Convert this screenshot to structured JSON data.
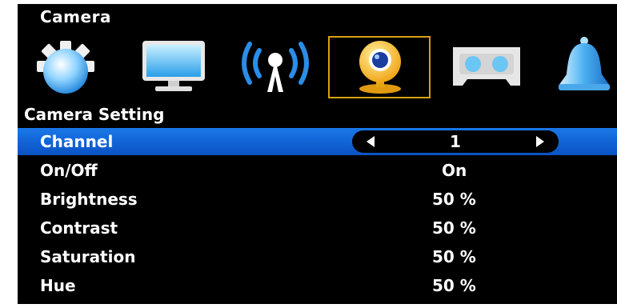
{
  "header": {
    "title": "Camera"
  },
  "icons": [
    {
      "name": "gear-icon"
    },
    {
      "name": "monitor-icon"
    },
    {
      "name": "wireless-icon"
    },
    {
      "name": "webcam-icon",
      "selected": true
    },
    {
      "name": "cassette-icon"
    },
    {
      "name": "bell-icon"
    }
  ],
  "section": {
    "title": "Camera Setting"
  },
  "settings": [
    {
      "label": "Channel",
      "value": "1",
      "selected": true
    },
    {
      "label": "On/Off",
      "value": "On"
    },
    {
      "label": "Brightness",
      "value": "50 %"
    },
    {
      "label": "Contrast",
      "value": "50 %"
    },
    {
      "label": "Saturation",
      "value": "50 %"
    },
    {
      "label": "Hue",
      "value": "50 %"
    }
  ],
  "colors": {
    "selection": "#1a6ee0",
    "frame": "#d8a012",
    "background": "#000000"
  }
}
